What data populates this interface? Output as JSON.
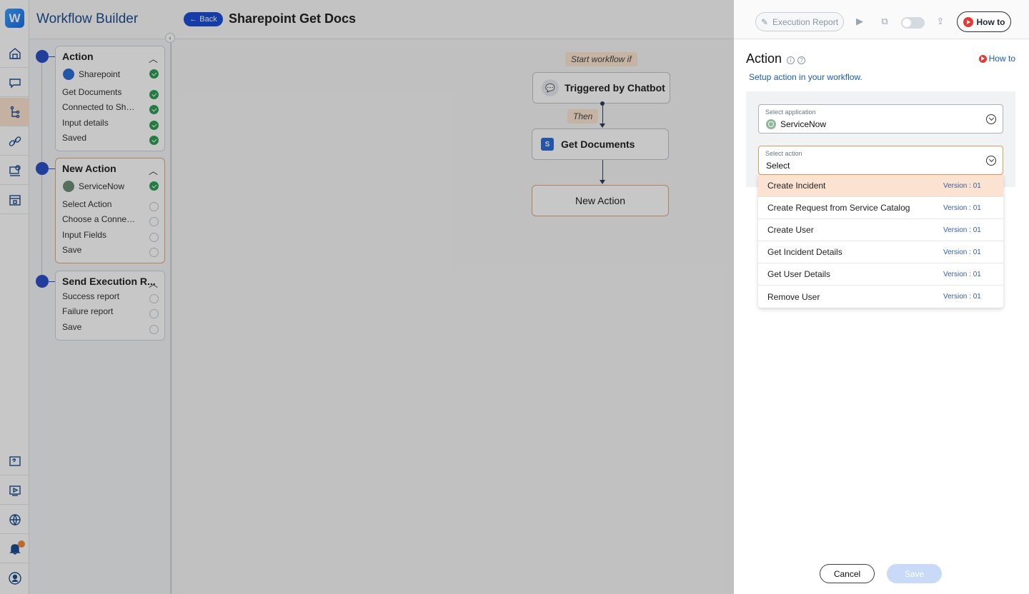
{
  "header": {
    "brand": "Workflow Builder",
    "back_label": "← Back",
    "title": "Sharepoint Get Docs",
    "execution_report": "Execution Report",
    "how_to": "How to"
  },
  "steps": [
    {
      "title": "Action",
      "app": "Sharepoint",
      "items": [
        "Get Documents",
        "Connected to Sha...",
        "Input details",
        "Saved"
      ]
    },
    {
      "title": "New Action",
      "app": "ServiceNow",
      "items": [
        "Select Action",
        "Choose a Connec...",
        "Input Fields",
        "Save"
      ]
    },
    {
      "title": "Send Execution R...",
      "items": [
        "Success report",
        "Failure report",
        "Save"
      ]
    }
  ],
  "canvas": {
    "start_label": "Start workflow if",
    "trigger_label": "Triggered by Chatbot",
    "then_label": "Then",
    "action_label": "Get Documents",
    "new_action_label": "New Action"
  },
  "panel": {
    "title": "Action",
    "info_glyph": "i",
    "help_glyph": "?",
    "how_to": "How to",
    "subtitle": "Setup action in your workflow.",
    "app_field": {
      "label": "Select application",
      "value": "ServiceNow"
    },
    "action_field": {
      "label": "Select action",
      "value": "Select"
    },
    "options": [
      {
        "name": "Create Incident",
        "version": "Version : 01"
      },
      {
        "name": "Create Request from Service Catalog",
        "version": "Version : 01"
      },
      {
        "name": "Create User",
        "version": "Version : 01"
      },
      {
        "name": "Get Incident Details",
        "version": "Version : 01"
      },
      {
        "name": "Get User Details",
        "version": "Version : 01"
      },
      {
        "name": "Remove User",
        "version": "Version : 01"
      }
    ],
    "cancel": "Cancel",
    "save": "Save"
  },
  "colors": {
    "accent_blue": "#2b50c6",
    "brand_blue": "#1c4f8f",
    "check_green": "#2f9e54",
    "highlight_orange": "#fbe2d1",
    "notification": "#f08a3c"
  },
  "icons": [
    "home-icon",
    "chat-icon",
    "workflow-icon",
    "link-icon",
    "training-icon",
    "lock-icon",
    "faq-icon",
    "video-icon",
    "globe-icon",
    "bell-icon",
    "user-icon"
  ]
}
